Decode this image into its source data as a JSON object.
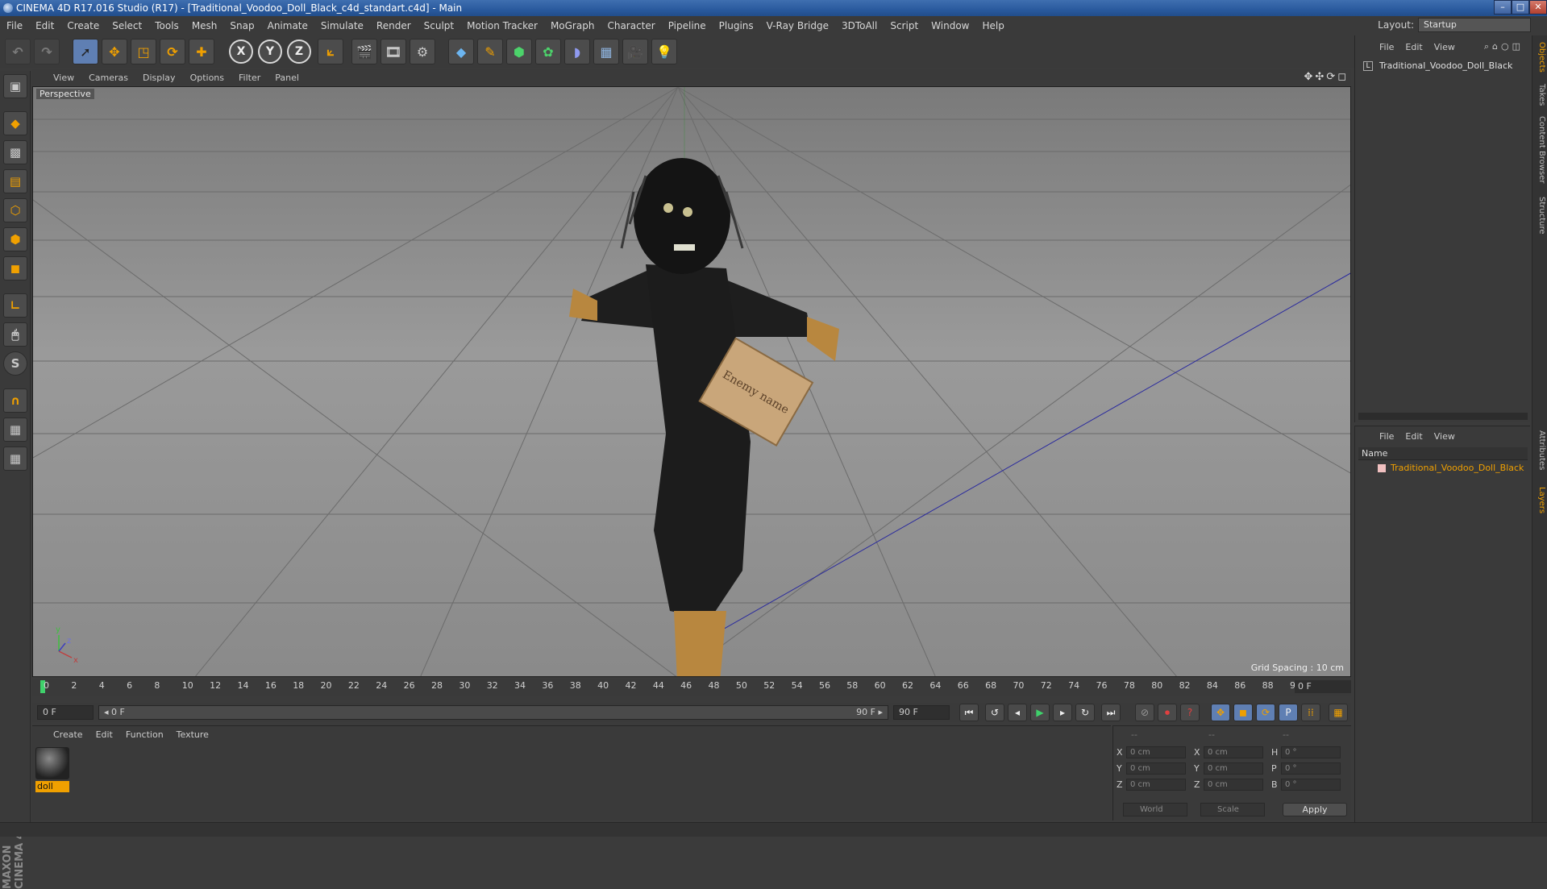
{
  "window": {
    "title": "CINEMA 4D R17.016 Studio (R17) - [Traditional_Voodoo_Doll_Black_c4d_standart.c4d] - Main",
    "min_glyph": "–",
    "max_glyph": "□",
    "close_glyph": "✕"
  },
  "menubar": {
    "items": [
      "File",
      "Edit",
      "Create",
      "Select",
      "Tools",
      "Mesh",
      "Snap",
      "Animate",
      "Simulate",
      "Render",
      "Sculpt",
      "Motion Tracker",
      "MoGraph",
      "Character",
      "Pipeline",
      "Plugins",
      "V-Ray Bridge",
      "3DToAll",
      "Script",
      "Window",
      "Help"
    ]
  },
  "layout": {
    "label": "Layout:",
    "value": "Startup"
  },
  "toolbar": {
    "axis_x": "X",
    "axis_y": "Y",
    "axis_z": "Z",
    "icons": [
      "undo-icon",
      "redo-icon",
      "select-icon",
      "move-icon",
      "scale-icon",
      "rotate-icon",
      "live-select-icon",
      "coord-icon",
      "render-view-icon",
      "render-picture-viewer-icon",
      "render-settings-icon",
      "cube-icon",
      "pen-icon",
      "subdivision-icon",
      "cloner-icon",
      "deformer-icon",
      "floor-icon",
      "camera-icon",
      "light-icon"
    ]
  },
  "viewport": {
    "menus": [
      "View",
      "Cameras",
      "Display",
      "Options",
      "Filter",
      "Panel"
    ],
    "label": "Perspective",
    "grid_spacing": "Grid Spacing : 10 cm",
    "nav_glyphs": "✥✣⟳◻",
    "tag_text": "Enemy name",
    "axis_y": "y",
    "axis_x": "x",
    "axis_z": "z"
  },
  "timeline": {
    "ticks": [
      "0",
      "2",
      "4",
      "6",
      "8",
      "10",
      "12",
      "14",
      "16",
      "18",
      "20",
      "22",
      "24",
      "26",
      "28",
      "30",
      "32",
      "34",
      "36",
      "38",
      "40",
      "42",
      "44",
      "46",
      "48",
      "50",
      "52",
      "54",
      "56",
      "58",
      "60",
      "62",
      "64",
      "66",
      "68",
      "70",
      "72",
      "74",
      "76",
      "78",
      "80",
      "82",
      "84",
      "86",
      "88",
      "90"
    ],
    "current_frame": "0 F"
  },
  "transport": {
    "start_field": "0 F",
    "range_start": "◂ 0 F",
    "range_end": "90 F ▸",
    "end_field": "90 F",
    "buttons": [
      "⏮",
      "↺",
      "◂",
      "▶",
      "▸",
      "↻",
      "⏭"
    ],
    "record_buttons": [
      "⊘",
      "⏺",
      "?"
    ],
    "key_buttons": [
      "✥",
      "◼",
      "⟳",
      "P",
      "⁞⁞"
    ]
  },
  "materials": {
    "menus": [
      "Create",
      "Edit",
      "Function",
      "Texture"
    ],
    "items": [
      {
        "name": "doll"
      }
    ]
  },
  "coordinates": {
    "header": [
      "--",
      "--",
      "--"
    ],
    "rows": [
      {
        "l1": "X",
        "v1": "0 cm",
        "l2": "X",
        "v2": "0 cm",
        "l3": "H",
        "v3": "0 °"
      },
      {
        "l1": "Y",
        "v1": "0 cm",
        "l2": "Y",
        "v2": "0 cm",
        "l3": "P",
        "v3": "0 °"
      },
      {
        "l1": "Z",
        "v1": "0 cm",
        "l2": "Z",
        "v2": "0 cm",
        "l3": "B",
        "v3": "0 °"
      }
    ],
    "mode_world": "World",
    "mode_scale": "Scale",
    "apply": "Apply"
  },
  "objects_panel": {
    "menus": [
      "File",
      "Edit",
      "View"
    ],
    "object_name": "Traditional_Voodoo_Doll_Black"
  },
  "layers_panel": {
    "menus": [
      "File",
      "Edit",
      "View"
    ],
    "header": "Name",
    "layer_name": "Traditional_Voodoo_Doll_Black"
  },
  "right_tabs": [
    "Objects",
    "Takes",
    "Content Browser",
    "Structure",
    "Attributes",
    "Layers"
  ],
  "branding": {
    "line1": "MAXON",
    "line2": "CINEMA 4D"
  },
  "colors": {
    "accent": "#f0a000",
    "title_blue": "#2a5a9e",
    "panel": "#3a3a3a"
  }
}
